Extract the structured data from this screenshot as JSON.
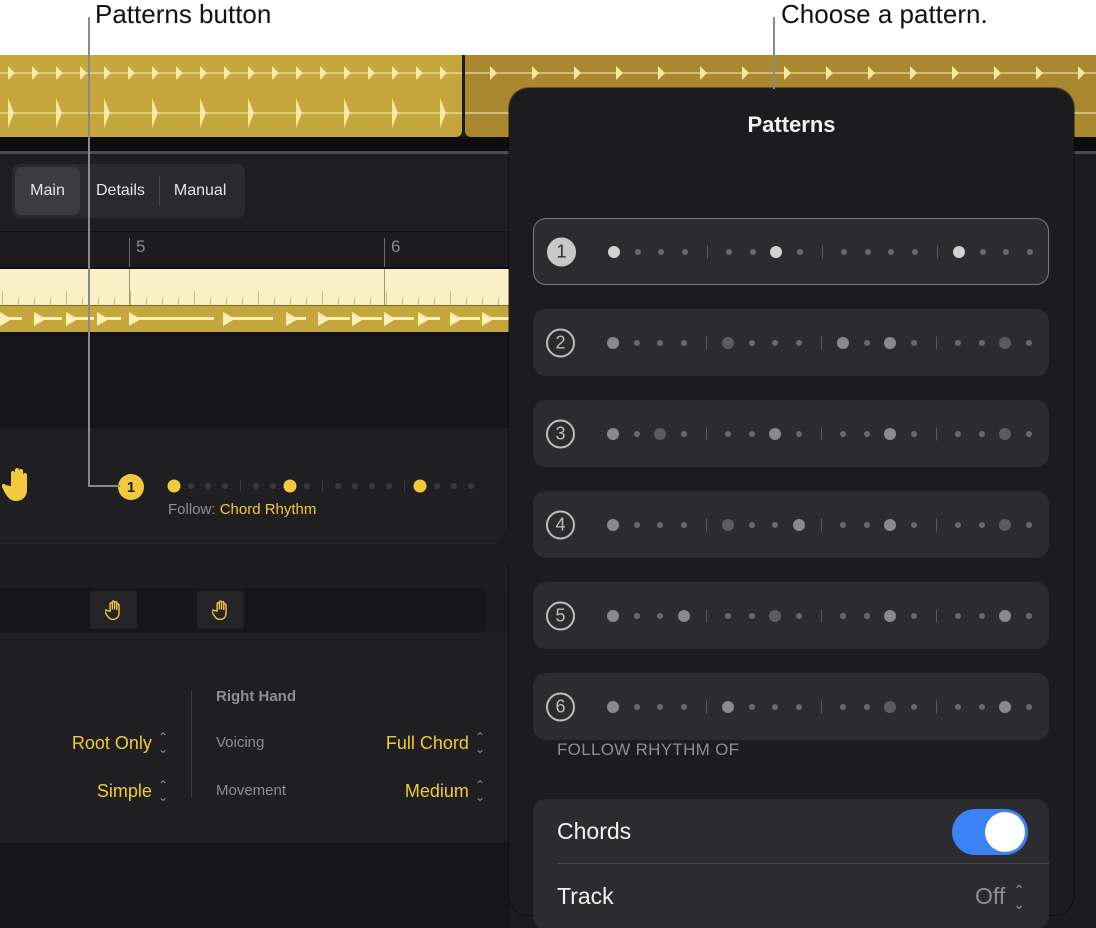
{
  "callouts": {
    "patterns_button": "Patterns button",
    "choose_pattern": "Choose a pattern."
  },
  "tabs": [
    {
      "label": "Main",
      "active": true
    },
    {
      "label": "Details",
      "active": false
    },
    {
      "label": "Manual",
      "active": false
    }
  ],
  "ruler": {
    "bars": [
      "5",
      "6"
    ]
  },
  "pattern_row": {
    "icon": "hand-icon",
    "badge": "1",
    "follow_label": "Follow:",
    "follow_value": "Chord Rhythm"
  },
  "settings": {
    "left_col": [
      {
        "value": "Root Only"
      },
      {
        "value": "Simple"
      }
    ],
    "right_hand": {
      "title": "Right Hand",
      "rows": [
        {
          "label": "Voicing",
          "value": "Full Chord"
        },
        {
          "label": "Movement",
          "value": "Medium"
        }
      ]
    }
  },
  "popover": {
    "title": "Patterns",
    "selected": 1,
    "patterns": [
      {
        "number": "1",
        "steps": [
          2,
          1,
          1,
          1,
          1,
          1,
          2,
          1,
          1,
          1,
          1,
          1,
          2,
          1,
          1,
          1
        ]
      },
      {
        "number": "2",
        "steps": [
          2,
          1,
          1,
          1,
          3,
          1,
          1,
          1,
          2,
          1,
          2,
          1,
          1,
          1,
          3,
          1
        ]
      },
      {
        "number": "3",
        "steps": [
          2,
          1,
          3,
          1,
          1,
          1,
          2,
          1,
          1,
          1,
          2,
          1,
          1,
          1,
          3,
          1
        ]
      },
      {
        "number": "4",
        "steps": [
          2,
          1,
          1,
          1,
          3,
          1,
          1,
          2,
          1,
          1,
          2,
          1,
          1,
          1,
          3,
          1
        ]
      },
      {
        "number": "5",
        "steps": [
          2,
          1,
          1,
          2,
          1,
          1,
          3,
          1,
          1,
          1,
          2,
          1,
          1,
          1,
          2,
          1
        ]
      },
      {
        "number": "6",
        "steps": [
          2,
          1,
          1,
          1,
          2,
          1,
          1,
          1,
          1,
          1,
          3,
          1,
          1,
          1,
          2,
          1
        ]
      }
    ],
    "section_label": "FOLLOW RHYTHM OF",
    "follow": {
      "chords_label": "Chords",
      "chords_on": true,
      "track_label": "Track",
      "track_value": "Off"
    }
  },
  "colors": {
    "accent_yellow": "#f2c93c",
    "toggle_blue": "#3a82f6",
    "region_gold": "#c4a63c"
  }
}
